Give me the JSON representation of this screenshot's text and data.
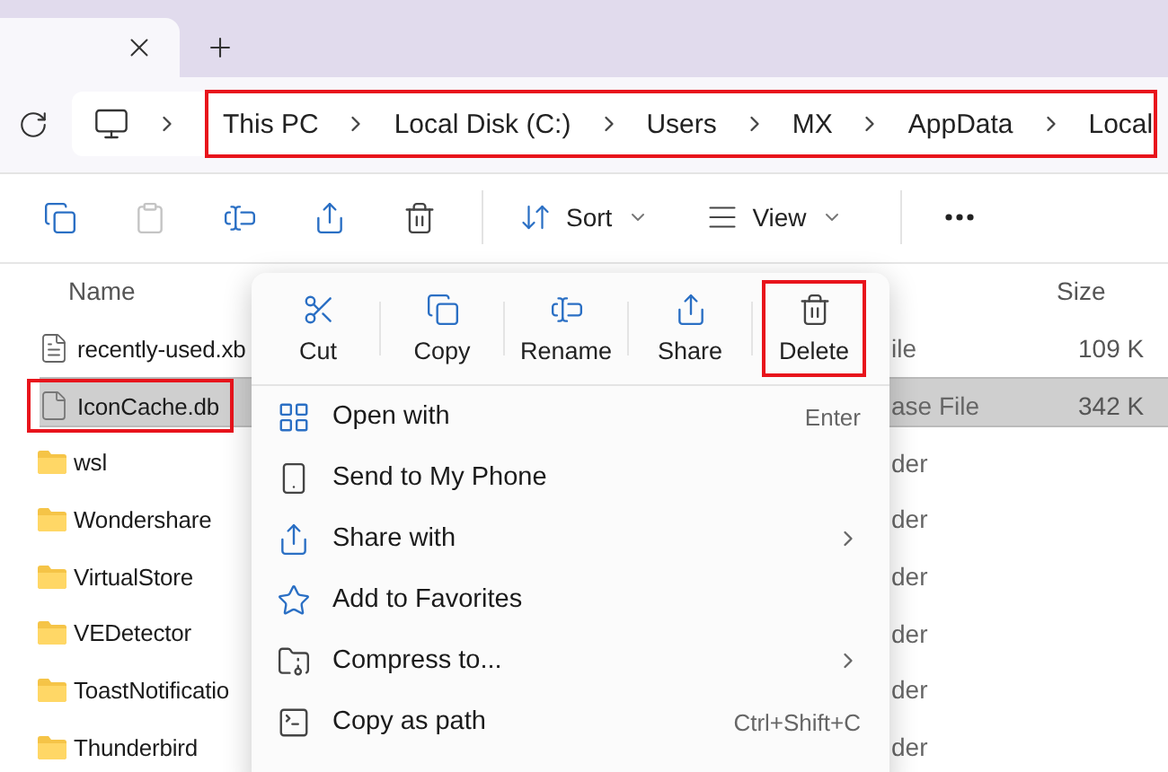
{
  "breadcrumb": {
    "segments": [
      "This PC",
      "Local Disk (C:)",
      "Users",
      "MX",
      "AppData",
      "Local"
    ],
    "highlighted": true
  },
  "toolbar": {
    "actions": [
      {
        "kind": "copy",
        "disabled": false
      },
      {
        "kind": "paste",
        "disabled": true
      },
      {
        "kind": "rename",
        "disabled": false
      },
      {
        "kind": "share",
        "disabled": false
      },
      {
        "kind": "delete",
        "disabled": false
      }
    ],
    "sort": "Sort",
    "view": "View"
  },
  "file_list": {
    "columns": {
      "name": "Name",
      "size": "Size"
    },
    "rows": [
      {
        "kind": "text",
        "name": "recently-used.xb",
        "type": "ile",
        "size": "109 K",
        "selected": false,
        "highlighted": false
      },
      {
        "kind": "db",
        "name": "IconCache.db",
        "type": "ase File",
        "size": "342 K",
        "selected": true,
        "highlighted": true
      },
      {
        "kind": "folder",
        "name": "wsl",
        "type": "der",
        "selected": false,
        "highlighted": false
      },
      {
        "kind": "folder",
        "name": "Wondershare",
        "type": "der",
        "selected": false,
        "highlighted": false
      },
      {
        "kind": "folder",
        "name": "VirtualStore",
        "type": "der",
        "selected": false,
        "highlighted": false
      },
      {
        "kind": "folder",
        "name": "VEDetector",
        "type": "der",
        "selected": false,
        "highlighted": false
      },
      {
        "kind": "folder",
        "name": "ToastNotificatio",
        "type": "der",
        "selected": false,
        "highlighted": false
      },
      {
        "kind": "folder",
        "name": "Thunderbird",
        "type": "der",
        "selected": false,
        "highlighted": false
      }
    ]
  },
  "context_menu": {
    "actions": [
      {
        "kind": "cut",
        "label": "Cut",
        "highlighted": false
      },
      {
        "kind": "copy",
        "label": "Copy",
        "highlighted": false
      },
      {
        "kind": "rename",
        "label": "Rename",
        "highlighted": false
      },
      {
        "kind": "share",
        "label": "Share",
        "highlighted": false
      },
      {
        "kind": "delete",
        "label": "Delete",
        "highlighted": true
      }
    ],
    "items": [
      {
        "kind": "open",
        "label": "Open with",
        "shortcut": "Enter",
        "submenu": false
      },
      {
        "kind": "phone",
        "label": "Send to My Phone",
        "submenu": false
      },
      {
        "kind": "share",
        "label": "Share with",
        "submenu": true
      },
      {
        "kind": "favorite",
        "label": "Add to Favorites",
        "submenu": false
      },
      {
        "kind": "compress",
        "label": "Compress to...",
        "submenu": true
      },
      {
        "kind": "path",
        "label": "Copy as path",
        "shortcut": "Ctrl+Shift+C",
        "submenu": false
      }
    ]
  }
}
